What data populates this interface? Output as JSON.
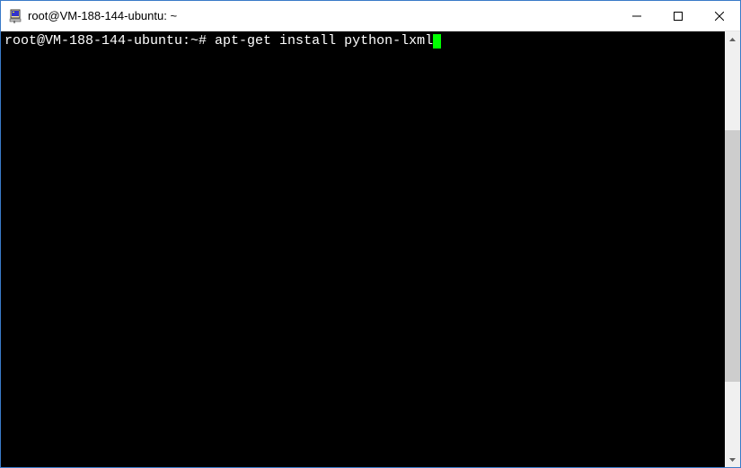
{
  "window": {
    "title": "root@VM-188-144-ubuntu: ~"
  },
  "terminal": {
    "prompt": "root@VM-188-144-ubuntu:~# ",
    "command": "apt-get install python-lxml"
  },
  "icons": {
    "app": "putty-icon",
    "minimize": "minimize-icon",
    "maximize": "maximize-icon",
    "close": "close-icon"
  }
}
